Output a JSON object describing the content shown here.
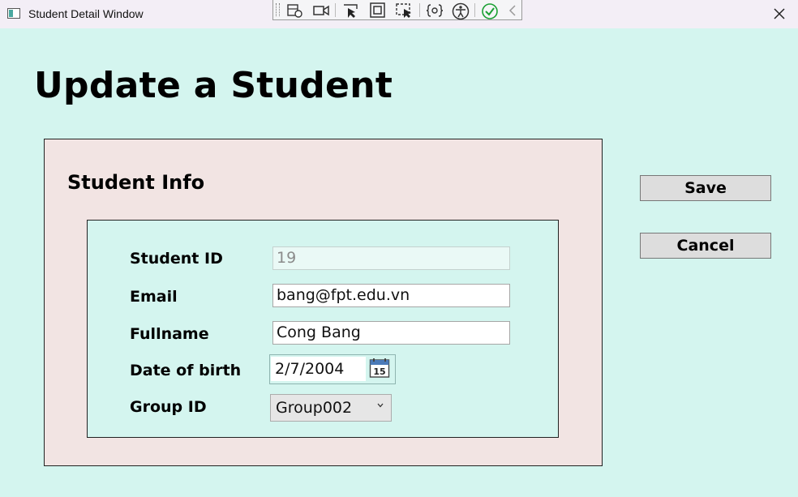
{
  "window": {
    "title": "Student Detail Window"
  },
  "debug_toolbar": {
    "icons": [
      "select-element-icon",
      "video-camera-icon",
      "pointer-select-icon",
      "layout-adorner-icon",
      "track-focus-icon",
      "binding-icon",
      "accessibility-icon",
      "checkmark-icon",
      "collapse-chevron-icon"
    ]
  },
  "page": {
    "heading": "Update a Student"
  },
  "student_info": {
    "title": "Student Info",
    "fields": {
      "student_id": {
        "label": "Student ID",
        "value": "19",
        "readonly": true
      },
      "email": {
        "label": "Email",
        "value": "bang@fpt.edu.vn"
      },
      "fullname": {
        "label": "Fullname",
        "value": "Cong Bang"
      },
      "dob": {
        "label": "Date of birth",
        "value": "2/7/2004",
        "calendar_day": "15"
      },
      "group_id": {
        "label": "Group ID",
        "value": "Group002"
      }
    }
  },
  "actions": {
    "save_label": "Save",
    "cancel_label": "Cancel"
  },
  "colors": {
    "background": "#d4f5ef",
    "outer_panel": "#f2e4e3",
    "titlebar": "#f3eef6",
    "button": "#dddddd"
  }
}
